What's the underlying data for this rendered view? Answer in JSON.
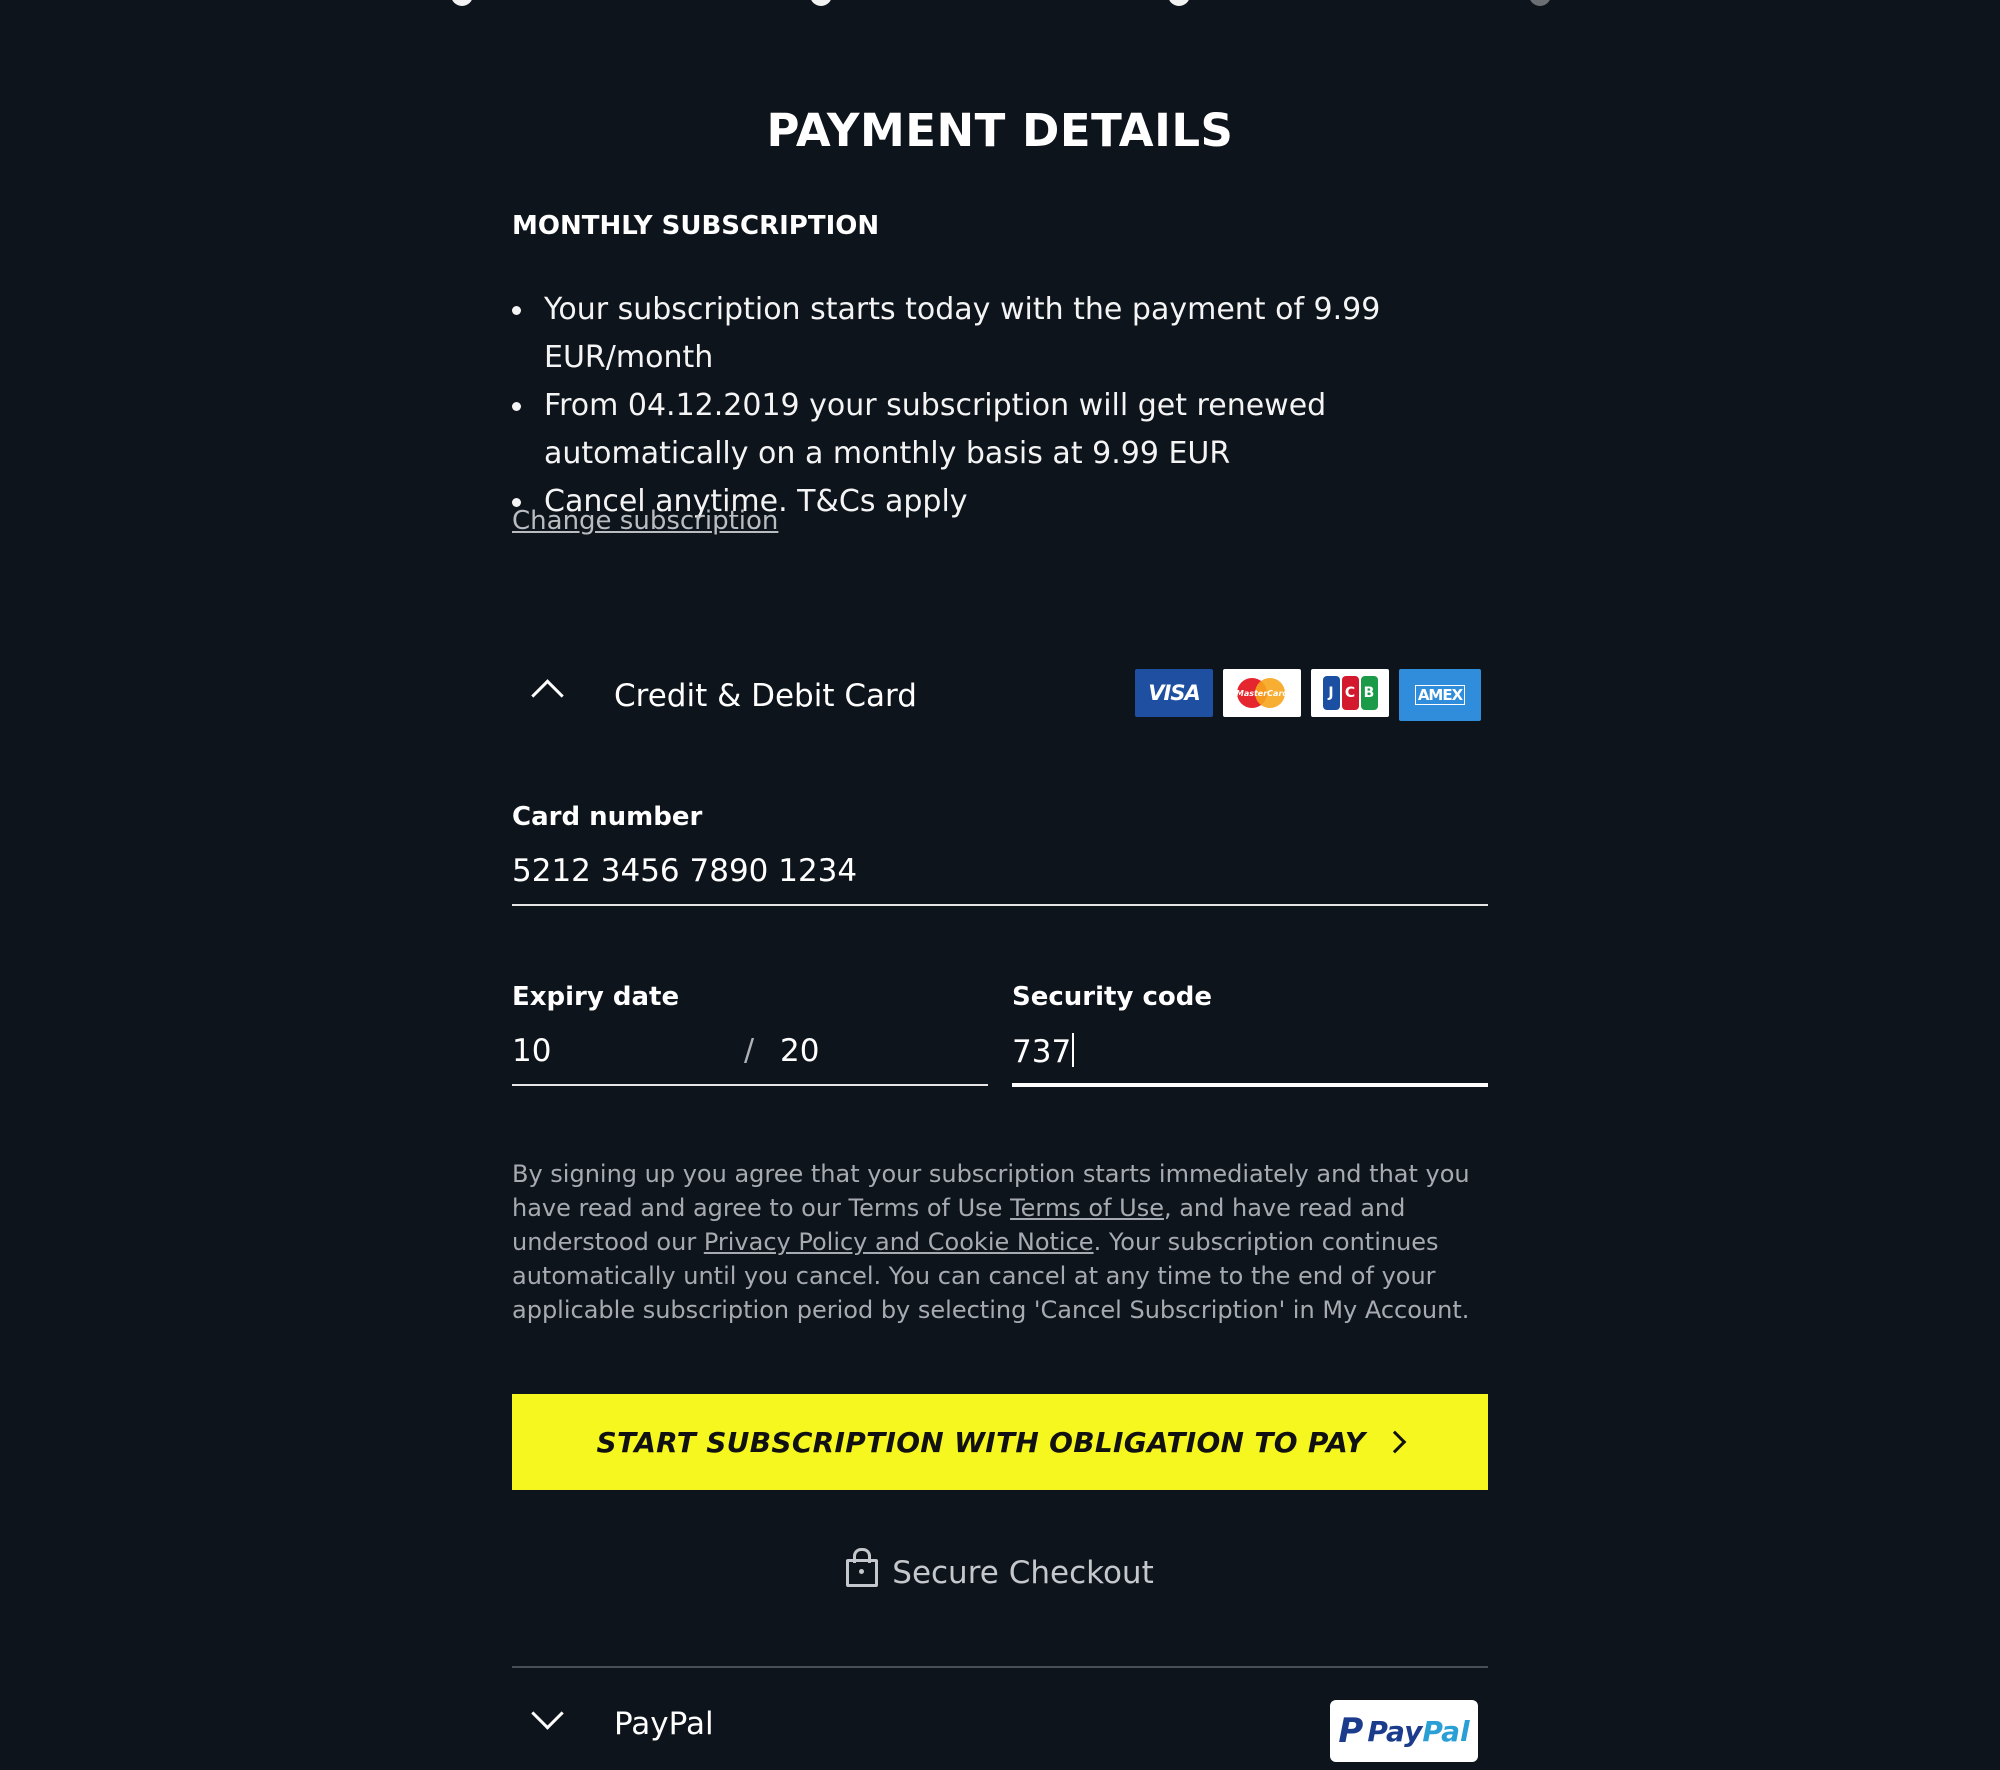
{
  "progress": {
    "steps": 4,
    "current": 3
  },
  "page_title": "PAYMENT DETAILS",
  "subscription": {
    "heading": "MONTHLY SUBSCRIPTION",
    "bullets": [
      "Your subscription starts today with the payment of 9.99 EUR/month",
      "From 04.12.2019 your subscription will get renewed automatically on a monthly basis at 9.99 EUR",
      "Cancel anytime. T&Cs apply"
    ],
    "change_link": "Change subscription"
  },
  "card_section": {
    "title": "Credit & Debit Card",
    "card_logos": [
      "visa-logo",
      "mastercard-logo",
      "jcb-logo",
      "amex-logo"
    ],
    "logo_text": {
      "visa": "VISA",
      "mastercard": "MasterCard",
      "jcb": [
        "J",
        "C",
        "B"
      ],
      "amex": "AMEX"
    },
    "card_number_label": "Card number",
    "card_number_value": "5212 3456 7890 1234",
    "expiry_label": "Expiry date",
    "expiry_month": "10",
    "expiry_separator": "/",
    "expiry_year": "20",
    "security_label": "Security code",
    "security_value": "737"
  },
  "legal": {
    "part1": "By signing up you agree that your subscription starts immediately and that you have read and agree to our Terms of Use ",
    "terms_link": "Terms of Use",
    "part2": ", and have read and understood our ",
    "privacy_link": "Privacy Policy and Cookie Notice",
    "part3": ". Your subscription continues automatically until you cancel. You can cancel at any time to the end of your applicable subscription period by selecting 'Cancel Subscription' in My Account."
  },
  "cta_label": "START SUBSCRIPTION WITH OBLIGATION TO PAY",
  "secure_checkout": "Secure Checkout",
  "paypal": {
    "title": "PayPal",
    "logo_pay": "Pay",
    "logo_pal": "Pal",
    "logo_mark": "P"
  },
  "colors": {
    "background": "#0e141b",
    "cta": "#f5f71e",
    "muted_text": "#a7abb1"
  }
}
